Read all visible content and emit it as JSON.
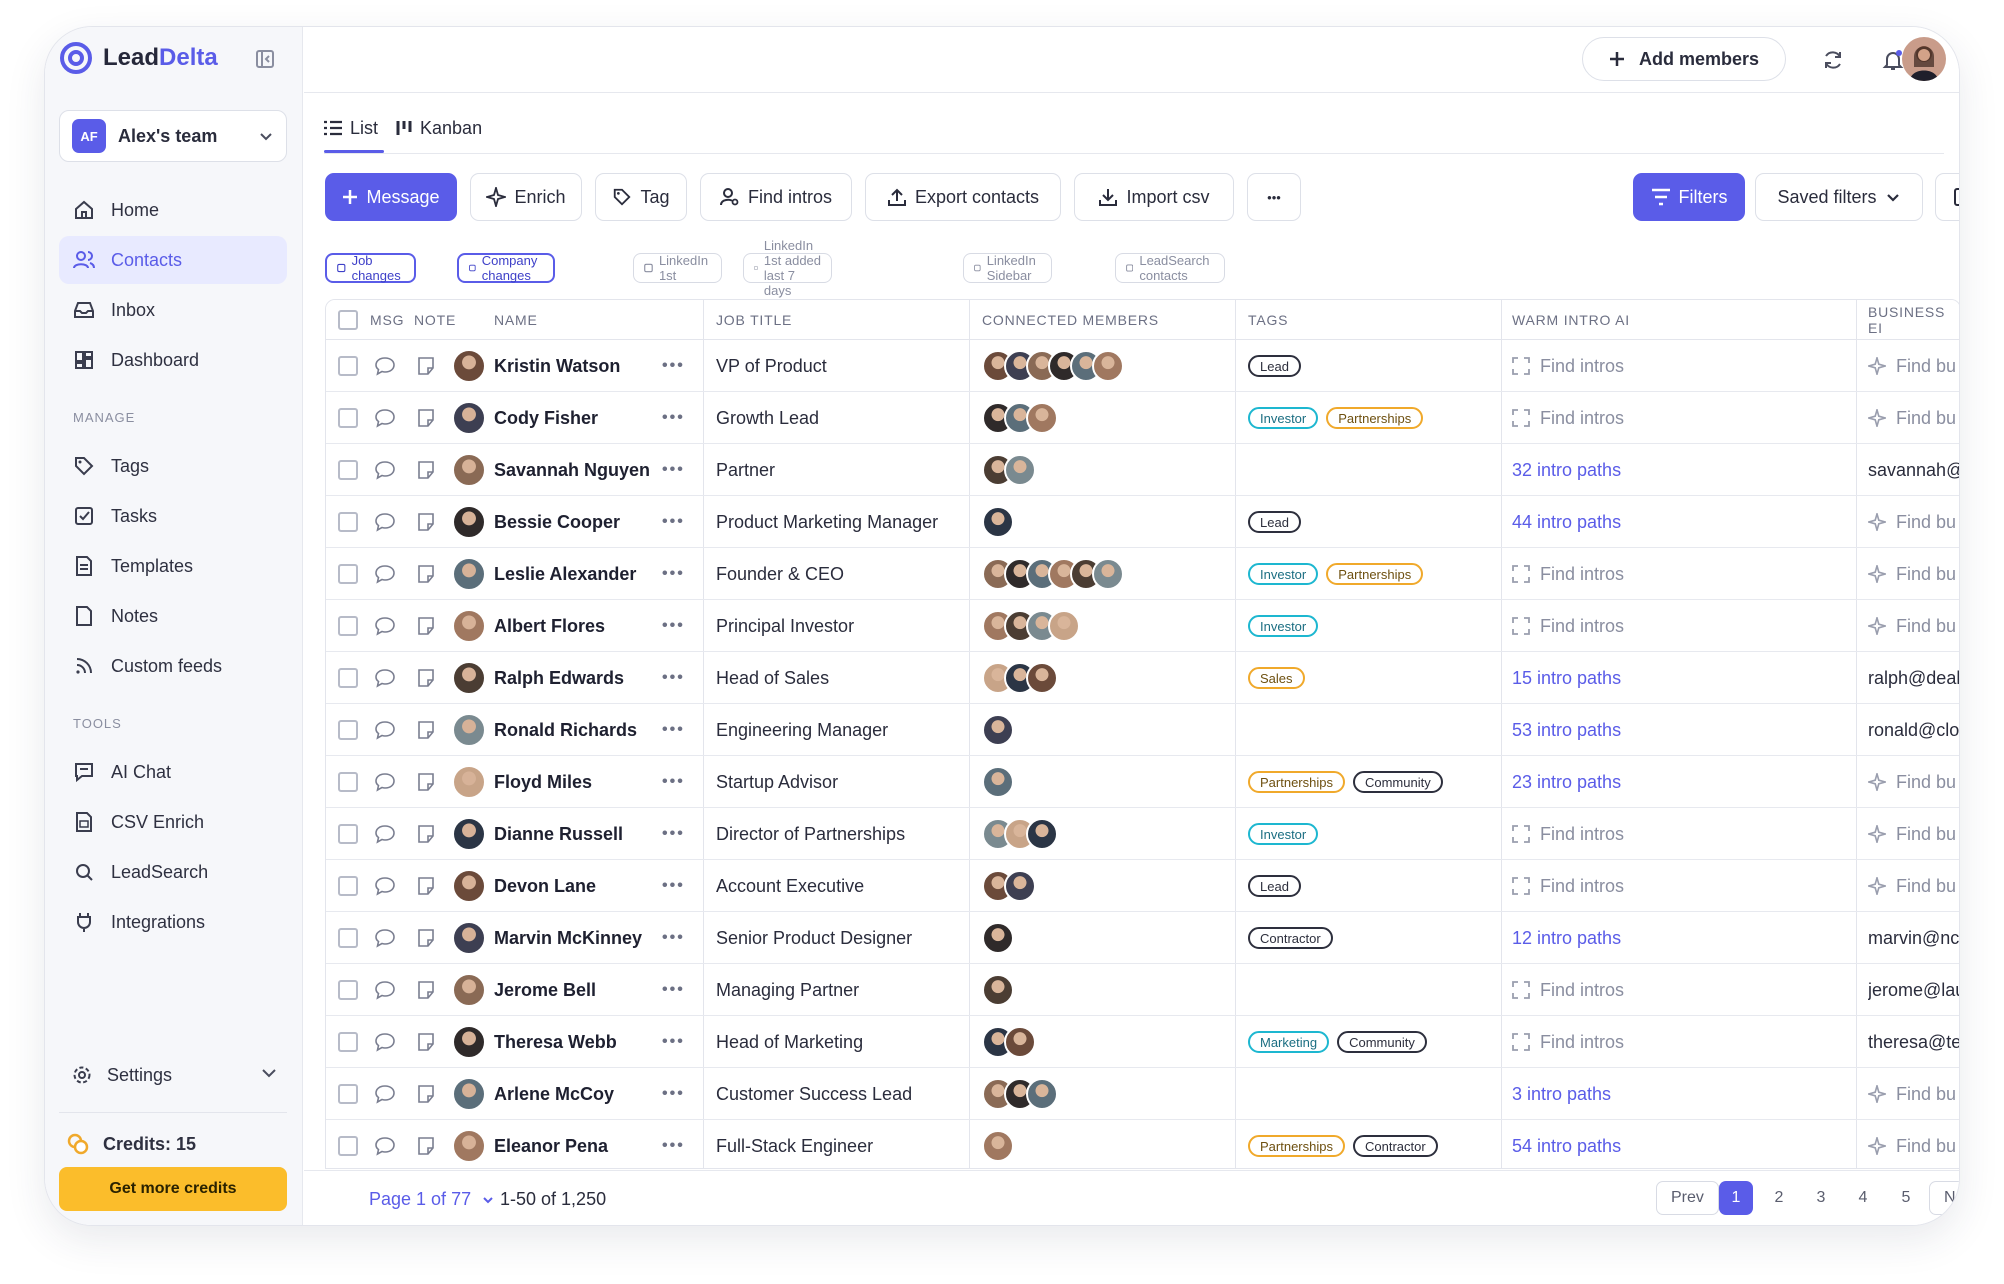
{
  "brand": {
    "name_a": "Lead",
    "name_b": "Delta"
  },
  "team": {
    "initials": "AF",
    "name": "Alex's team"
  },
  "nav": {
    "home": "Home",
    "contacts": "Contacts",
    "inbox": "Inbox",
    "dashboard": "Dashboard"
  },
  "manage": {
    "label": "MANAGE",
    "tags": "Tags",
    "tasks": "Tasks",
    "templates": "Templates",
    "notes": "Notes",
    "custom_feeds": "Custom feeds"
  },
  "tools": {
    "label": "TOOLS",
    "ai_chat": "AI Chat",
    "csv_enrich": "CSV Enrich",
    "leadsearch": "LeadSearch",
    "integrations": "Integrations"
  },
  "settings_label": "Settings",
  "credits": {
    "label": "Credits: 15",
    "button": "Get more credits"
  },
  "topbar": {
    "add_members": "Add members"
  },
  "views": {
    "list": "List",
    "kanban": "Kanban"
  },
  "toolbar": {
    "message": "Message",
    "enrich": "Enrich",
    "tag": "Tag",
    "find_intros": "Find intros",
    "export": "Export contacts",
    "import": "Import csv",
    "more": "•••",
    "filters": "Filters",
    "saved_filters": "Saved filters"
  },
  "chips": [
    "Job changes",
    "Company changes",
    "LinkedIn 1st",
    "LinkedIn 1st added last 7 days",
    "LinkedIn Sidebar",
    "LeadSearch contacts"
  ],
  "columns": {
    "msg": "MSG",
    "note": "NOTE",
    "name": "NAME",
    "job_title": "JOB TITLE",
    "connected": "CONNECTED MEMBERS",
    "tags": "TAGS",
    "warm_intro": "WARM INTRO AI",
    "business": "BUSINESS EI"
  },
  "colors": {
    "accent": "#5a5ce8",
    "credits_button": "#fbbd2b",
    "tag_investor": "#1db7d0",
    "tag_partnerships": "#f0a92b"
  },
  "rows": [
    {
      "name": "Kristin Watson",
      "title": "VP of Product",
      "members": 6,
      "tags": [
        "Lead"
      ],
      "intro": "Find intros",
      "intro_found": false,
      "business": "Find bu",
      "business_found": false
    },
    {
      "name": "Cody Fisher",
      "title": "Growth Lead",
      "members": 3,
      "tags": [
        "Investor",
        "Partnerships"
      ],
      "intro": "Find intros",
      "intro_found": false,
      "business": "Find bu",
      "business_found": false
    },
    {
      "name": "Savannah Nguyen",
      "title": "Partner",
      "members": 2,
      "tags": [],
      "intro": "32 intro paths",
      "intro_found": true,
      "business": "savannah@",
      "business_found": true
    },
    {
      "name": "Bessie Cooper",
      "title": "Product Marketing Manager",
      "members": 1,
      "tags": [
        "Lead"
      ],
      "intro": "44 intro paths",
      "intro_found": true,
      "business": "Find bu",
      "business_found": false
    },
    {
      "name": "Leslie Alexander",
      "title": "Founder & CEO",
      "members": 6,
      "tags": [
        "Investor",
        "Partnerships"
      ],
      "intro": "Find intros",
      "intro_found": false,
      "business": "Find bu",
      "business_found": false
    },
    {
      "name": "Albert Flores",
      "title": "Principal Investor",
      "members": 4,
      "tags": [
        "Investor"
      ],
      "intro": "Find intros",
      "intro_found": false,
      "business": "Find bu",
      "business_found": false
    },
    {
      "name": "Ralph Edwards",
      "title": "Head of Sales",
      "members": 3,
      "tags": [
        "Sales"
      ],
      "intro": "15 intro paths",
      "intro_found": true,
      "business": "ralph@deal",
      "business_found": true
    },
    {
      "name": "Ronald Richards",
      "title": "Engineering Manager",
      "members": 1,
      "tags": [],
      "intro": "53 intro paths",
      "intro_found": true,
      "business": "ronald@clo",
      "business_found": true
    },
    {
      "name": "Floyd Miles",
      "title": "Startup Advisor",
      "members": 1,
      "tags": [
        "Partnerships",
        "Community"
      ],
      "intro": "23 intro paths",
      "intro_found": true,
      "business": "Find bu",
      "business_found": false
    },
    {
      "name": "Dianne Russell",
      "title": "Director of Partnerships",
      "members": 3,
      "tags": [
        "Investor"
      ],
      "intro": "Find intros",
      "intro_found": false,
      "business": "Find bu",
      "business_found": false
    },
    {
      "name": "Devon Lane",
      "title": "Account Executive",
      "members": 2,
      "tags": [
        "Lead"
      ],
      "intro": "Find intros",
      "intro_found": false,
      "business": "Find bu",
      "business_found": false
    },
    {
      "name": "Marvin McKinney",
      "title": "Senior Product Designer",
      "members": 1,
      "tags": [
        "Contractor"
      ],
      "intro": "12 intro paths",
      "intro_found": true,
      "business": "marvin@nc",
      "business_found": true
    },
    {
      "name": "Jerome Bell",
      "title": "Managing Partner",
      "members": 1,
      "tags": [],
      "intro": "Find intros",
      "intro_found": false,
      "business": "jerome@lau",
      "business_found": true
    },
    {
      "name": "Theresa Webb",
      "title": "Head of Marketing",
      "members": 2,
      "tags": [
        "Marketing",
        "Community"
      ],
      "intro": "Find intros",
      "intro_found": false,
      "business": "theresa@te",
      "business_found": true
    },
    {
      "name": "Arlene McCoy",
      "title": "Customer Success Lead",
      "members": 3,
      "tags": [],
      "intro": "3 intro paths",
      "intro_found": true,
      "business": "Find bu",
      "business_found": false
    },
    {
      "name": "Eleanor Pena",
      "title": "Full-Stack Engineer",
      "members": 1,
      "tags": [
        "Partnerships",
        "Contractor"
      ],
      "intro": "54 intro paths",
      "intro_found": true,
      "business": "Find bu",
      "business_found": false
    }
  ],
  "footer": {
    "page": "Page 1 of 77",
    "range": "1-50 of 1,250",
    "prev": "Prev",
    "next": "Next",
    "pages": [
      "1",
      "2",
      "3",
      "4",
      "5"
    ]
  }
}
